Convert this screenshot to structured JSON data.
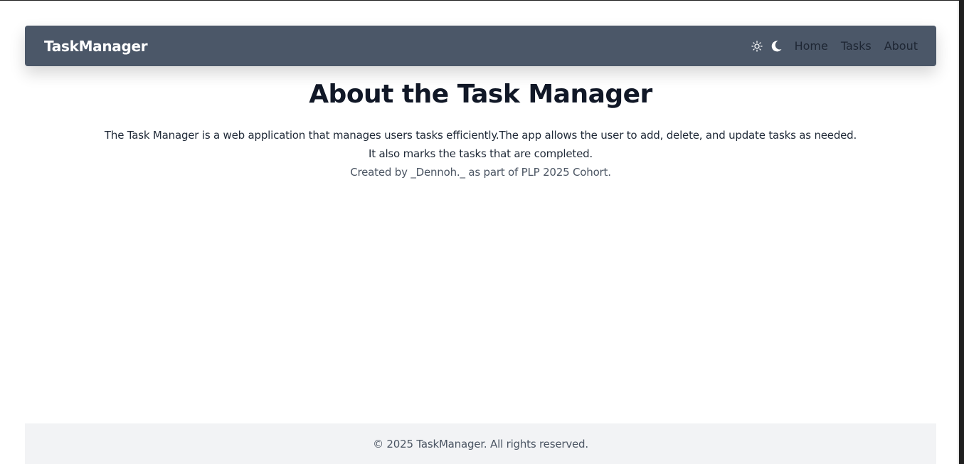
{
  "navbar": {
    "brand": "TaskManager",
    "theme_toggles": [
      {
        "name": "light-mode",
        "icon": "sun-icon"
      },
      {
        "name": "dark-mode",
        "icon": "moon-icon"
      }
    ],
    "links": [
      "Home",
      "Tasks",
      "About"
    ],
    "background_color": "#4b5768"
  },
  "main": {
    "title": "About the Task Manager",
    "description": "The Task Manager is a web application that manages users tasks efficiently.The app allows the user to add, delete, and update tasks as needed. It also marks the tasks that are completed.",
    "credit": "Created by _Dennoh._ as part of PLP 2025 Cohort."
  },
  "footer": {
    "text": "© 2025 TaskManager. All rights reserved."
  }
}
